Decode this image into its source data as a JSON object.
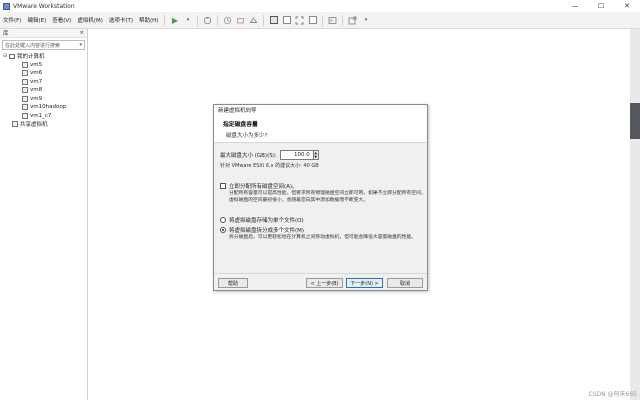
{
  "window": {
    "title": "VMware Workstation",
    "controls": {
      "minimize": "—",
      "maximize": "☐",
      "close": "✕"
    }
  },
  "menu": [
    "文件(F)",
    "编辑(E)",
    "查看(V)",
    "虚拟机(M)",
    "选项卡(T)",
    "帮助(H)"
  ],
  "toolbar": {
    "play_glyph": "▶",
    "dropdown_glyph": "▾"
  },
  "library": {
    "title": "库",
    "close_glyph": "×",
    "search_placeholder": "在此处键入内容进行搜索",
    "root_label": "我的计算机",
    "toggle_glyph": "⊟",
    "vms": [
      "vm5",
      "vm6",
      "vm7",
      "vm8",
      "vm9",
      "vm10hadoop",
      "vm1_c7"
    ],
    "shared_label": "共享虚拟机"
  },
  "dialog": {
    "title": "新建虚拟机向导",
    "heading": "指定磁盘容量",
    "subheading": "磁盘大小为多少?",
    "size_label": "最大磁盘大小 (GB)(S):",
    "size_value": "100.0",
    "recommend": "针对 VMware ESXi 6.x 的建议大小: 40 GB",
    "allocate_label": "立即分配所有磁盘空间(A)。",
    "allocate_desc": "分配所有容量可以提高性能，但要求所有物理磁盘空间立即可用。如果不立即分配所有空间，虚拟磁盘的空间最初很小，会随着您向其中添加数据而不断变大。",
    "single_label": "将虚拟磁盘存储为单个文件(O)",
    "split_label": "将虚拟磁盘拆分成多个文件(M)",
    "split_desc": "拆分磁盘后，可以更轻松地在计算机之间移动虚拟机，但可能会降低大容量磁盘的性能。",
    "buttons": {
      "help": "帮助",
      "back": "< 上一步(B)",
      "next": "下一步(N) >",
      "cancel": "取消"
    },
    "selected_option": "split"
  },
  "watermark": "CSDN @阿禾665"
}
